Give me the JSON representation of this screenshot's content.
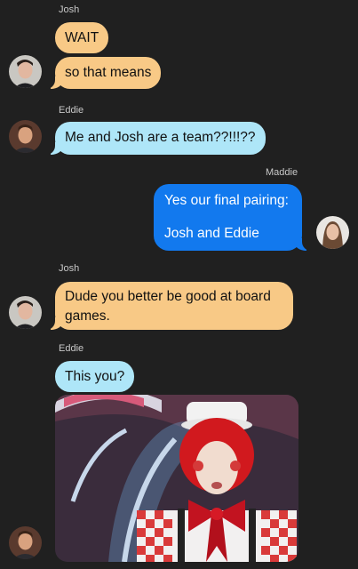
{
  "messages": [
    {
      "sender": "Josh",
      "text": "WAIT"
    },
    {
      "text": "so that means"
    },
    {
      "sender": "Eddie",
      "text": "Me and Josh are a team??!!!??"
    },
    {
      "sender": "Maddie",
      "text_line1": "Yes our final pairing:",
      "text_line2": "Josh and Eddie"
    },
    {
      "sender": "Josh",
      "text_line1": "Dude you better be good at board",
      "text_line2": "games."
    },
    {
      "sender": "Eddie",
      "text": "This you?"
    }
  ],
  "attachment": {
    "icon": "clown-photo"
  },
  "colors": {
    "background": "#202020",
    "josh_bubble": "#f8c986",
    "eddie_bubble": "#aee6f8",
    "self_bubble": "#1279ee"
  }
}
